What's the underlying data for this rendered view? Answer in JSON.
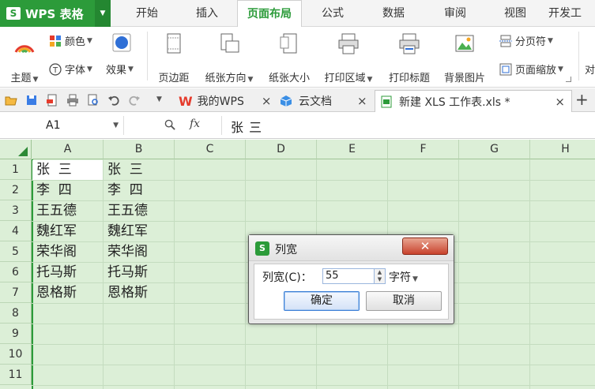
{
  "app": {
    "title": "WPS 表格",
    "logo_letter": "S"
  },
  "menu": {
    "tabs": [
      "开始",
      "插入",
      "页面布局",
      "公式",
      "数据",
      "审阅",
      "视图",
      "开发工"
    ],
    "active": "页面布局"
  },
  "ribbon": {
    "theme": "主题",
    "colors": "颜色",
    "fonts": "字体",
    "effects": "效果",
    "margins": "页边距",
    "orientation": "纸张方向",
    "size": "纸张大小",
    "print_area": "打印区域",
    "print_titles": "打印标题",
    "background": "背景图片",
    "page_break": "分页符",
    "page_zoom": "页面缩放",
    "cut_off": "对"
  },
  "tabs_bar": {
    "my_wps": "我的WPS",
    "cloud_docs": "云文档",
    "document": "新建 XLS 工作表.xls *",
    "close": "×",
    "new": "+"
  },
  "formula_bar": {
    "name_box": "A1",
    "fx": "fx",
    "value": "张  三"
  },
  "grid": {
    "columns": [
      "A",
      "B",
      "C",
      "D",
      "E",
      "F",
      "G",
      "H"
    ],
    "rows": [
      "1",
      "2",
      "3",
      "4",
      "5",
      "6",
      "7",
      "8",
      "9",
      "10",
      "11"
    ],
    "col_a": [
      "张  三",
      "李  四",
      "王五德",
      "魏红军",
      "荣华阁",
      "托马斯",
      "恩格斯"
    ],
    "col_b": [
      "张  三",
      "李  四",
      "王五德",
      "魏红军",
      "荣华阁",
      "托马斯",
      "恩格斯"
    ]
  },
  "dialog": {
    "title": "列宽",
    "close": "✕",
    "width_label": "列宽(C)：",
    "width_value": "55",
    "unit": "字符",
    "ok": "确定",
    "cancel": "取消"
  },
  "colors": {
    "brand_green": "#2c9b3a",
    "grid_bg": "#dcefd7"
  }
}
